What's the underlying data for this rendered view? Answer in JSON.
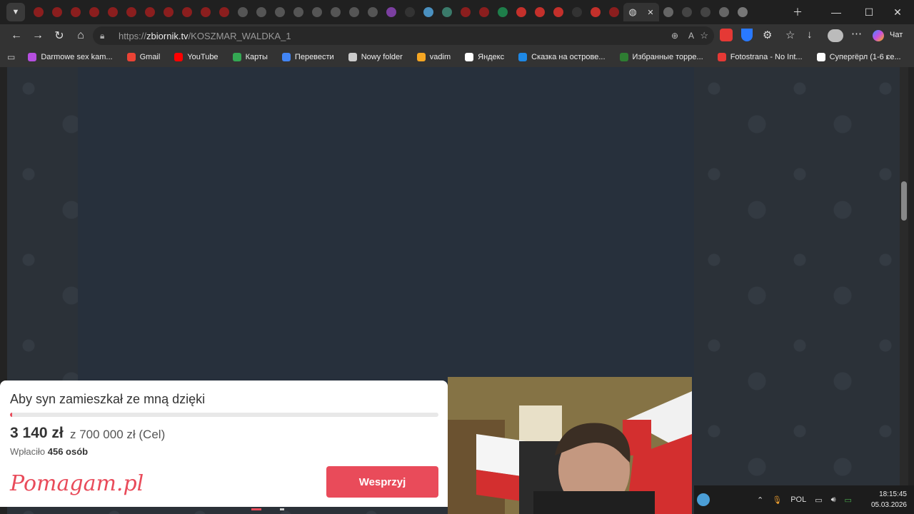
{
  "browser": {
    "url_prefix": "https://",
    "url_domain": "zbiornik.tv",
    "url_path": "/KOSZMAR_WALDKA_1",
    "copilot_label": "Чат"
  },
  "bookmarks": [
    {
      "label": "Darmowe sex kam...",
      "color": "#b64fe0"
    },
    {
      "label": "Gmail",
      "color": "#ea4335"
    },
    {
      "label": "YouTube",
      "color": "#ff0000"
    },
    {
      "label": "Карты",
      "color": "#34a853"
    },
    {
      "label": "Перевести",
      "color": "#4285f4"
    },
    {
      "label": "Nowy folder",
      "color": "#cccccc"
    },
    {
      "label": "vadim",
      "color": "#f5a623"
    },
    {
      "label": "Яндекс",
      "color": "#ffffff"
    },
    {
      "label": "Сказка на острове...",
      "color": "#1e88e5"
    },
    {
      "label": "Избранные торре...",
      "color": "#2e7d32"
    },
    {
      "label": "Fotostrana - No Int...",
      "color": "#e53935"
    },
    {
      "label": "Суперrёрл (1-6 се...",
      "color": "#ffffff"
    }
  ],
  "donation": {
    "title": "Aby syn zamieszkał ze mną dzięki",
    "amount": "3 140 zł",
    "goal": "z 700 000 zł (Cel)",
    "count_label": "Wpłaciło",
    "count_value": "456 osób",
    "logo": "Pomagam.pl",
    "button": "Wesprzyj",
    "progress": 0.0045
  },
  "taskbar": {
    "language": "POL",
    "time": "18:15:45",
    "date": "05.03.2026"
  }
}
